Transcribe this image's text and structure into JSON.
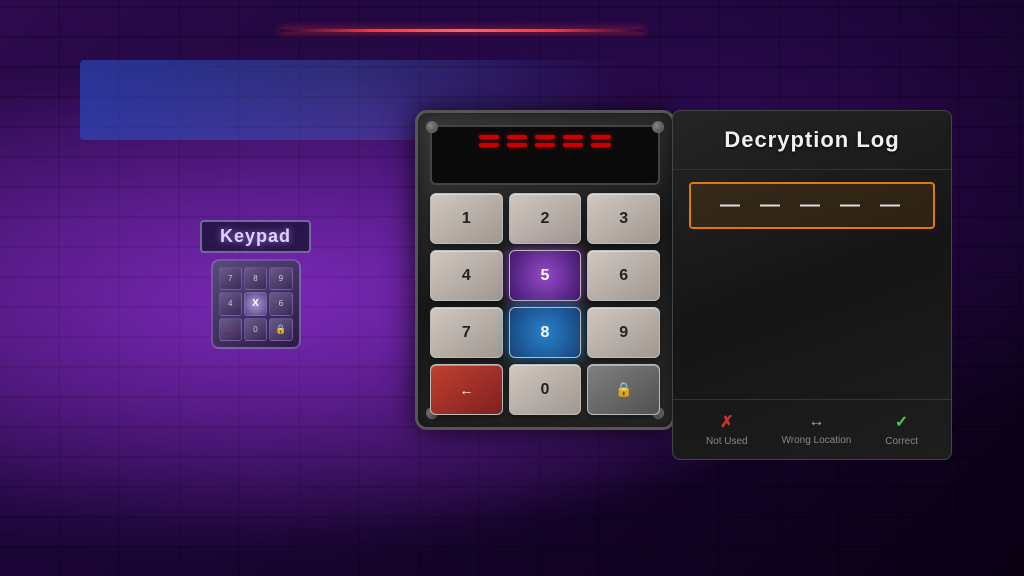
{
  "background": {
    "color": "#1a0a2e"
  },
  "small_keypad": {
    "label": "Keypad",
    "keys": [
      "7",
      "8",
      "9",
      "X",
      "",
      "",
      "",
      "",
      ""
    ]
  },
  "main_keypad": {
    "display_rows": [
      [
        "dash",
        "dash",
        "dash",
        "dash",
        "dash"
      ],
      [
        "dash",
        "dash",
        "dash",
        "dash",
        "dash"
      ]
    ],
    "keys": [
      {
        "label": "1",
        "style": "normal"
      },
      {
        "label": "2",
        "style": "normal"
      },
      {
        "label": "3",
        "style": "normal"
      },
      {
        "label": "4",
        "style": "normal"
      },
      {
        "label": "5",
        "style": "highlighted-purple"
      },
      {
        "label": "6",
        "style": "normal"
      },
      {
        "label": "7",
        "style": "normal"
      },
      {
        "label": "8",
        "style": "highlighted-blue"
      },
      {
        "label": "9",
        "style": "normal"
      },
      {
        "label": "←",
        "style": "backspace"
      },
      {
        "label": "0",
        "style": "zero"
      },
      {
        "label": "🔒",
        "style": "lock"
      }
    ]
  },
  "decryption_log": {
    "title": "Decryption Log",
    "input_dashes": [
      "—",
      "—",
      "—",
      "—",
      "—"
    ],
    "legend": [
      {
        "icon": "✗",
        "label": "Not Used",
        "type": "wrong"
      },
      {
        "icon": "↔",
        "label": "Wrong Location",
        "type": "partial"
      },
      {
        "icon": "✓",
        "label": "Correct",
        "type": "correct"
      }
    ]
  }
}
